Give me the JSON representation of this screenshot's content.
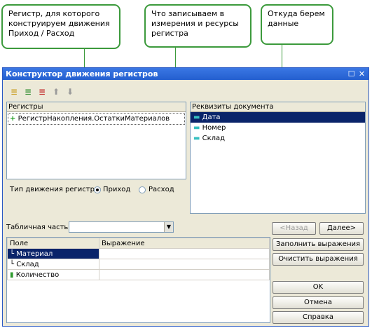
{
  "callouts": [
    {
      "text": "Регистр, для которого конструируем движения Приход / Расход"
    },
    {
      "text": "Что записываем в измерения и ресурсы регистра"
    },
    {
      "text": "Откуда берем данные"
    }
  ],
  "window": {
    "title": "Конструктор движения регистров",
    "restore_glyph": "☐",
    "close_glyph": "✕"
  },
  "toolbar": {
    "icons": [
      "register-select-icon",
      "register-add-icon",
      "register-delete-icon",
      "move-up-icon",
      "move-down-icon"
    ],
    "glyphs": [
      "≣",
      "≣",
      "≣",
      "⬆",
      "⬇"
    ]
  },
  "registers": {
    "header": "Регистры",
    "items": [
      {
        "label": "РегистрНакопления.ОстаткиМатериалов",
        "icon": "+"
      }
    ]
  },
  "requisites": {
    "header": "Реквизиты документа",
    "items": [
      {
        "label": "Дата",
        "selected": true
      },
      {
        "label": "Номер",
        "selected": false
      },
      {
        "label": "Склад",
        "selected": false
      }
    ]
  },
  "movement_type": {
    "label": "Тип движения регистра:",
    "options": [
      {
        "label": "Приход",
        "checked": true
      },
      {
        "label": "Расход",
        "checked": false
      }
    ]
  },
  "tabular": {
    "label": "Табличная часть:",
    "value": ""
  },
  "nav": {
    "back": "<Назад",
    "next": "Далее>"
  },
  "grid": {
    "columns": [
      "Поле",
      "Выражение"
    ],
    "rows": [
      {
        "field": "Материал",
        "expression": ""
      },
      {
        "field": "Склад",
        "expression": ""
      },
      {
        "field": "Количество",
        "expression": ""
      }
    ]
  },
  "buttons": {
    "fill": "Заполнить выражения",
    "clear": "Очистить выражения",
    "ok": "OK",
    "cancel": "Отмена",
    "help": "Справка"
  },
  "colors": {
    "callout_border": "#3c9a3c",
    "title_bar": "#245fcf",
    "selection": "#0a246a"
  }
}
